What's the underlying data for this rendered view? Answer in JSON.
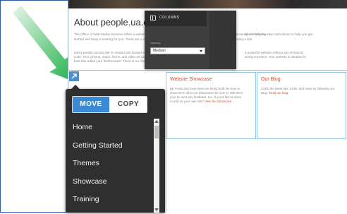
{
  "page": {
    "about_title": "About people.ua.edu",
    "about_lines": [
      "The Office of Web Media Services offers a website platform, people.ua.edu, to students, faculty and staff at The University of Alabama.",
      "started and keep it working for you. There are a number of resources available for those who are interested in creating a site."
    ],
    "about_lines_right": [
      "all and step-by-step instructions to help you get",
      "",
      "a powerful website without any technical",
      "word processor. Your website is situated in"
    ],
    "body_lines": [
      "Every people.ua.edu site is created and hosted on a WordPress installation.",
      "code. Text, photos, maps, forms, and video all can be added with ease.",
      "host bits within your first browser. There is no charge for students, faculty or staff."
    ],
    "showcase": {
      "title": "Website Showcase",
      "text": [
        "ple Posts and more sites are being built. Be sure to",
        "show them off in our Showcase! Be sure to visit them",
        "your be sent any feedback, too. If you'd like to share",
        "to add on your own site?"
      ],
      "link": "View the Showcase."
    },
    "blog": {
      "title": "Our Blog",
      "text": [
        "Catch the latest tips, tricks, and news by following our",
        "blog."
      ],
      "link": "Read our blog."
    }
  },
  "columns_popup": {
    "icon": "columns-icon",
    "title": "COLUMNS",
    "field_label": "Spacing",
    "select_value": "Medium"
  },
  "menu": {
    "move_label": "MOVE",
    "copy_label": "COPY",
    "active": "MOVE",
    "items": [
      "Home",
      "Getting Started",
      "Themes",
      "Showcase",
      "Training"
    ]
  },
  "colors": {
    "accent": "#3b8ad6",
    "menu_bg": "#2f2f2f",
    "annotation_arrow": "#22c55e",
    "link": "#d24a2a"
  }
}
